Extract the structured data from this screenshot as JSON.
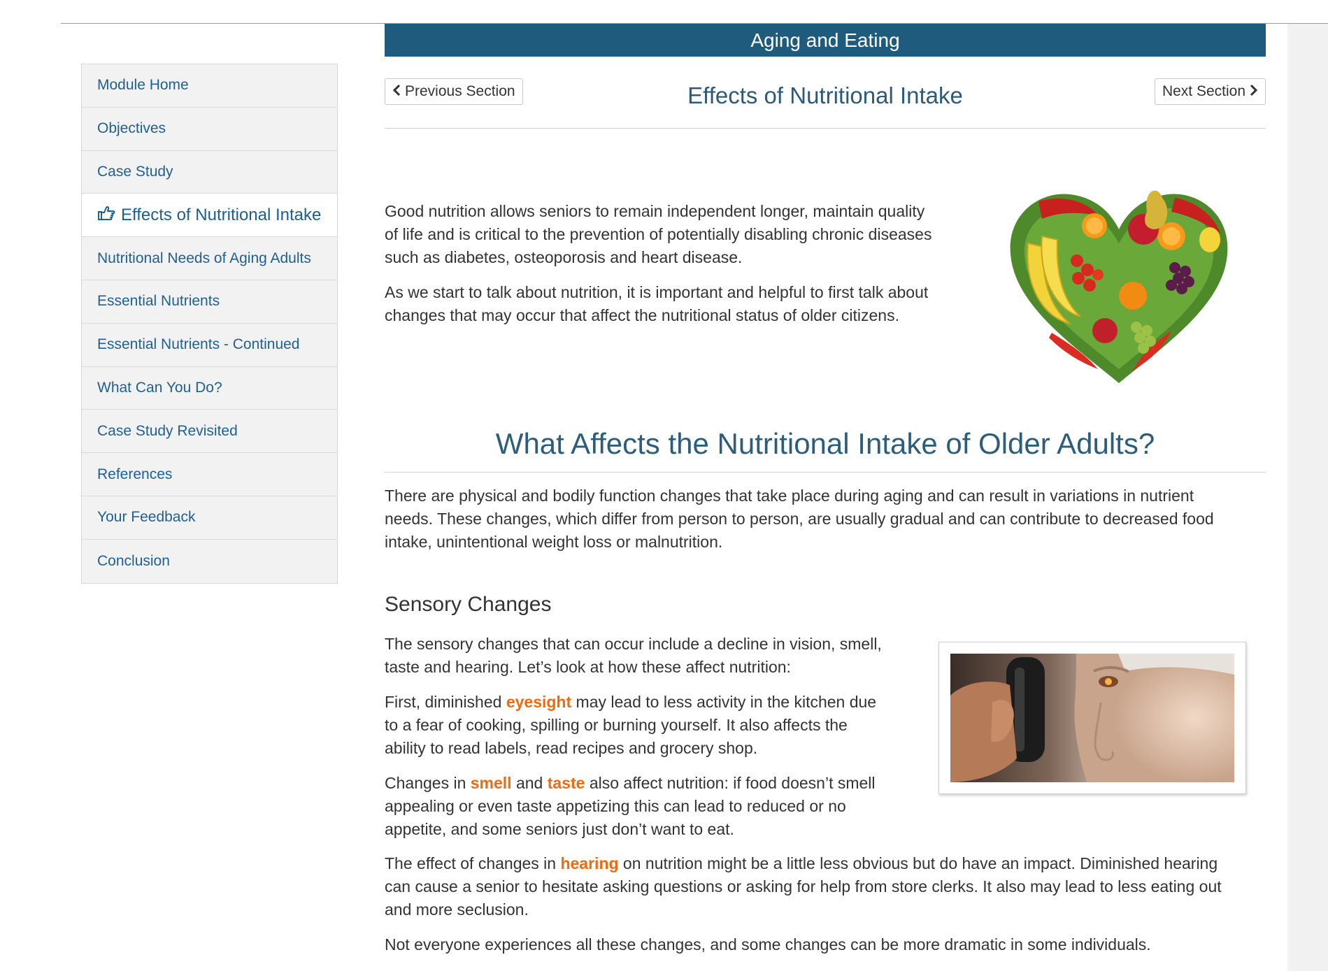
{
  "module": {
    "title": "Aging and Eating"
  },
  "sidebar": {
    "items": [
      {
        "label": "Module Home"
      },
      {
        "label": "Objectives"
      },
      {
        "label": "Case Study"
      },
      {
        "label": "Effects of Nutritional Intake",
        "active": true
      },
      {
        "label": "Nutritional Needs of Aging Adults"
      },
      {
        "label": "Essential Nutrients"
      },
      {
        "label": "Essential Nutrients - Continued"
      },
      {
        "label": "What Can You Do?"
      },
      {
        "label": "Case Study Revisited"
      },
      {
        "label": "References"
      },
      {
        "label": "Your Feedback"
      },
      {
        "label": "Conclusion"
      }
    ],
    "active_icon": "hand-pointing-right-icon"
  },
  "nav": {
    "previous_label": "Previous Section",
    "next_label": "Next Section",
    "section_title": "Effects of Nutritional Intake"
  },
  "intro": {
    "paragraph_1_lines": [
      "Good nutrition allows seniors to remain independent longer, maintain quality",
      "of life and is critical to the prevention of potentially disabling chronic diseases",
      "such as diabetes, osteoporosis and heart disease."
    ],
    "paragraph_2_lines": [
      "As we start to talk about nutrition, it is important and helpful to first talk about",
      "changes that may occur that affect the nutritional status of older citizens."
    ]
  },
  "section": {
    "heading": "What Affects the Nutritional Intake of Older Adults?",
    "paragraph_lines": [
      "There are physical and bodily function changes that take place during aging and can result in variations in nutrient",
      "needs. These changes, which differ from person to person, are usually gradual and can contribute to decreased food",
      "intake, unintentional weight loss or malnutrition."
    ]
  },
  "sensory": {
    "heading": "Sensory Changes",
    "p1_lines": [
      "The sensory changes that can occur include a decline in vision, smell,",
      "taste and hearing. Let’s look at how these affect nutrition:"
    ],
    "p2": {
      "l1_pre": "First, diminished ",
      "l1_hl": "eyesight",
      "l1_post": " may lead to less activity in the kitchen due",
      "l2": "to a fear of cooking, spilling or burning yourself. It also affects the",
      "l3": "ability to read labels, read recipes and grocery shop."
    },
    "p3": {
      "l1_pre": "Changes in ",
      "l1_hl1": "smell",
      "l1_mid": " and ",
      "l1_hl2": "taste",
      "l1_post": " also affect nutrition: if food doesn’t smell",
      "l2": "appealing or even taste appetizing this can lead to reduced or no",
      "l3": "appetite, and some seniors just don’t want to eat."
    },
    "p4": {
      "l1_pre": "The effect of changes in ",
      "l1_hl": "hearing",
      "l1_post": " on nutrition might be a little less obvious but do have an impact. Diminished hearing",
      "l2": "can cause a senior to hesitate asking questions or asking for help from store clerks. It also may lead to less eating out",
      "l3": "and more seclusion."
    },
    "p5": "Not everyone experiences all these changes, and some changes can be more dramatic in some individuals."
  },
  "colors": {
    "module_bar": "#1f5b7d",
    "link": "#1f5f92",
    "heading": "#2c5d7b",
    "highlight": "#f06a10",
    "text": "#333333"
  }
}
